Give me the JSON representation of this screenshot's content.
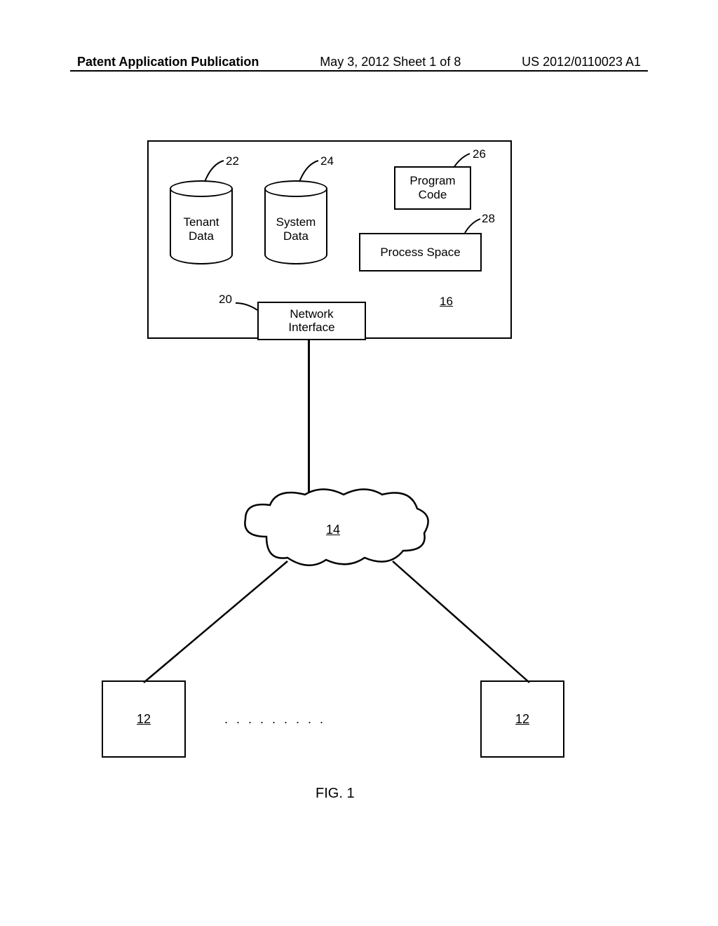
{
  "header": {
    "left": "Patent Application Publication",
    "center": "May 3, 2012  Sheet 1 of 8",
    "right": "US 2012/0110023 A1"
  },
  "main_box": {
    "tenant_data": "Tenant\nData",
    "system_data": "System\nData",
    "program_code": "Program\nCode",
    "process_space": "Process Space",
    "network_interface": "Network\nInterface",
    "ref_16": "16",
    "ref_22": "22",
    "ref_24": "24",
    "ref_26": "26",
    "ref_28": "28",
    "ref_20": "20"
  },
  "cloud": {
    "ref_14": "14"
  },
  "clients": {
    "left": "12",
    "right": "12",
    "dots": "........."
  },
  "figure_label": "FIG. 1"
}
